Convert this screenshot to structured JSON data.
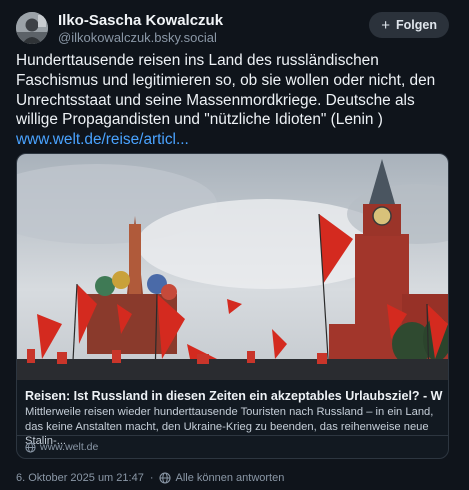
{
  "author": {
    "display_name": "Ilko-Sascha Kowalczuk",
    "handle": "@ilkokowalczuk.bsky.social"
  },
  "follow_button": {
    "label": "Folgen"
  },
  "post": {
    "text": "Hunderttausende reisen ins Land des russländischen Faschismus und legitimieren so, ob sie wollen oder nicht, den Unrechtsstaat und seine Massenmordkriege. Deutsche als willige Propagandisten und \"nützliche Idioten\" (Lenin ) ",
    "link_text": "www.welt.de/reise/articl..."
  },
  "link_card": {
    "title": "Reisen: Ist Russland in diesen Zeiten ein akzeptables Urlaubsziel?  - WELT",
    "description": "Mittlerweile reisen wieder hunderttausende Touristen nach Russland – in ein Land, das keine Anstalten macht, den Ukraine-Krieg zu beenden, das reihenweise neue Stalin-...",
    "domain": "www.welt.de"
  },
  "footer": {
    "timestamp": "6. Oktober 2025 um 21:47",
    "reply_setting": "Alle können antworten"
  },
  "colors": {
    "background": "#0f141b",
    "link": "#4aa3ff",
    "muted": "#8a97a6",
    "flag_red": "#d42a1f",
    "kremlin_brick": "#a2362b"
  },
  "icons": [
    "avatar-photo",
    "plus-icon",
    "globe-icon",
    "reply-settings-icon"
  ]
}
